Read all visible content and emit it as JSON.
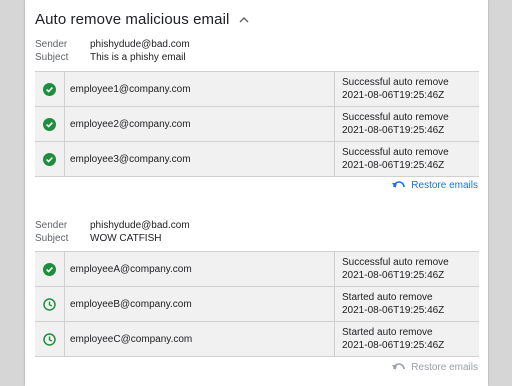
{
  "header": {
    "title": "Auto remove malicious email",
    "collapse_icon": "chevron-up-icon"
  },
  "colors": {
    "success": "#1e8e3e",
    "link": "#1a73e8",
    "disabled": "#9aa0a6"
  },
  "groups": [
    {
      "sender_label": "Sender",
      "sender": "phishydude@bad.com",
      "subject_label": "Subject",
      "subject": "This is a phishy email",
      "rows": [
        {
          "icon": "check-circle-icon",
          "email": "employee1@company.com",
          "status": "Successful auto remove",
          "time": "2021-08-06T19:25:46Z"
        },
        {
          "icon": "check-circle-icon",
          "email": "employee2@company.com",
          "status": "Successful auto remove",
          "time": "2021-08-06T19:25:46Z"
        },
        {
          "icon": "check-circle-icon",
          "email": "employee3@company.com",
          "status": "Successful auto remove",
          "time": "2021-08-06T19:25:46Z"
        }
      ],
      "restore_label": "Restore emails",
      "restore_enabled": true
    },
    {
      "sender_label": "Sender",
      "sender": "phishydude@bad.com",
      "subject_label": "Subject",
      "subject": "WOW CATFISH",
      "rows": [
        {
          "icon": "check-circle-icon",
          "email": "employeeA@company.com",
          "status": "Successful auto remove",
          "time": "2021-08-06T19:25:46Z"
        },
        {
          "icon": "clock-icon",
          "email": "employeeB@company.com",
          "status": "Started auto remove",
          "time": "2021-08-06T19:25:46Z"
        },
        {
          "icon": "clock-icon",
          "email": "employeeC@company.com",
          "status": "Started auto remove",
          "time": "2021-08-06T19:25:46Z"
        }
      ],
      "restore_label": "Restore emails",
      "restore_enabled": false
    }
  ]
}
